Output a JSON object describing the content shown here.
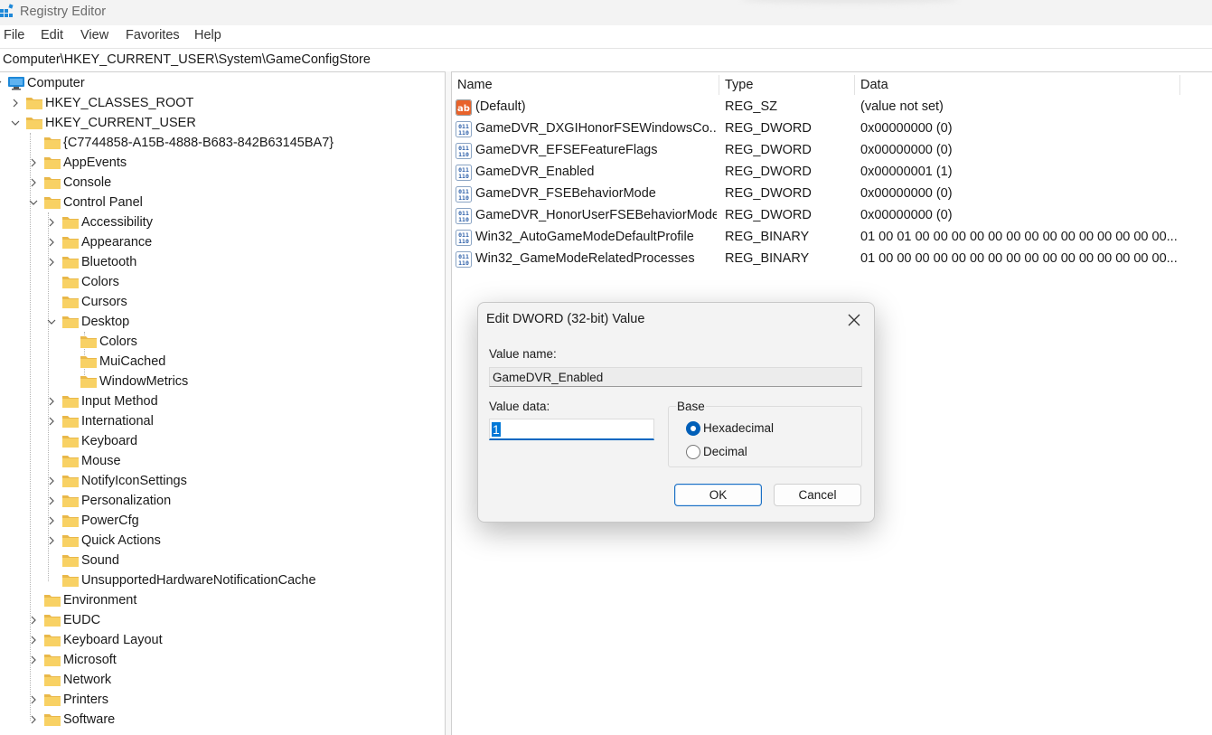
{
  "window": {
    "title": "Registry Editor"
  },
  "menu": [
    "File",
    "Edit",
    "View",
    "Favorites",
    "Help"
  ],
  "address": "Computer\\HKEY_CURRENT_USER\\System\\GameConfigStore",
  "tree": [
    {
      "label": "Computer",
      "icon": "computer-icon",
      "chevron": "down"
    },
    {
      "label": "HKEY_CLASSES_ROOT",
      "icon": "folder-icon",
      "chevron": "right"
    },
    {
      "label": "HKEY_CURRENT_USER",
      "icon": "folder-icon",
      "chevron": "down"
    },
    {
      "label": "{C7744858-A15B-4888-B683-842B63145BA7}",
      "icon": "folder-icon",
      "chevron": "none"
    },
    {
      "label": "AppEvents",
      "icon": "folder-icon",
      "chevron": "right"
    },
    {
      "label": "Console",
      "icon": "folder-icon",
      "chevron": "right"
    },
    {
      "label": "Control Panel",
      "icon": "folder-icon",
      "chevron": "down"
    },
    {
      "label": "Accessibility",
      "icon": "folder-icon",
      "chevron": "right"
    },
    {
      "label": "Appearance",
      "icon": "folder-icon",
      "chevron": "right"
    },
    {
      "label": "Bluetooth",
      "icon": "folder-icon",
      "chevron": "right"
    },
    {
      "label": "Colors",
      "icon": "folder-icon",
      "chevron": "none"
    },
    {
      "label": "Cursors",
      "icon": "folder-icon",
      "chevron": "none"
    },
    {
      "label": "Desktop",
      "icon": "folder-icon",
      "chevron": "down"
    },
    {
      "label": "Colors",
      "icon": "folder-icon",
      "chevron": "none"
    },
    {
      "label": "MuiCached",
      "icon": "folder-icon",
      "chevron": "none"
    },
    {
      "label": "WindowMetrics",
      "icon": "folder-icon",
      "chevron": "none"
    },
    {
      "label": "Input Method",
      "icon": "folder-icon",
      "chevron": "right"
    },
    {
      "label": "International",
      "icon": "folder-icon",
      "chevron": "right"
    },
    {
      "label": "Keyboard",
      "icon": "folder-icon",
      "chevron": "none"
    },
    {
      "label": "Mouse",
      "icon": "folder-icon",
      "chevron": "none"
    },
    {
      "label": "NotifyIconSettings",
      "icon": "folder-icon",
      "chevron": "right"
    },
    {
      "label": "Personalization",
      "icon": "folder-icon",
      "chevron": "right"
    },
    {
      "label": "PowerCfg",
      "icon": "folder-icon",
      "chevron": "right"
    },
    {
      "label": "Quick Actions",
      "icon": "folder-icon",
      "chevron": "right"
    },
    {
      "label": "Sound",
      "icon": "folder-icon",
      "chevron": "none"
    },
    {
      "label": "UnsupportedHardwareNotificationCache",
      "icon": "folder-icon",
      "chevron": "none"
    },
    {
      "label": "Environment",
      "icon": "folder-icon",
      "chevron": "none"
    },
    {
      "label": "EUDC",
      "icon": "folder-icon",
      "chevron": "right"
    },
    {
      "label": "Keyboard Layout",
      "icon": "folder-icon",
      "chevron": "right"
    },
    {
      "label": "Microsoft",
      "icon": "folder-icon",
      "chevron": "right"
    },
    {
      "label": "Network",
      "icon": "folder-icon",
      "chevron": "none"
    },
    {
      "label": "Printers",
      "icon": "folder-icon",
      "chevron": "right"
    },
    {
      "label": "Software",
      "icon": "folder-icon",
      "chevron": "right"
    }
  ],
  "columns": {
    "name": "Name",
    "type": "Type",
    "data": "Data"
  },
  "values": [
    {
      "name": "(Default)",
      "type": "REG_SZ",
      "data": "(value not set)",
      "icon": "string-value-icon"
    },
    {
      "name": "GameDVR_DXGIHonorFSEWindowsCo...",
      "type": "REG_DWORD",
      "data": "0x00000000 (0)",
      "icon": "binary-value-icon"
    },
    {
      "name": "GameDVR_EFSEFeatureFlags",
      "type": "REG_DWORD",
      "data": "0x00000000 (0)",
      "icon": "binary-value-icon"
    },
    {
      "name": "GameDVR_Enabled",
      "type": "REG_DWORD",
      "data": "0x00000001 (1)",
      "icon": "binary-value-icon"
    },
    {
      "name": "GameDVR_FSEBehaviorMode",
      "type": "REG_DWORD",
      "data": "0x00000000 (0)",
      "icon": "binary-value-icon"
    },
    {
      "name": "GameDVR_HonorUserFSEBehaviorMode",
      "type": "REG_DWORD",
      "data": "0x00000000 (0)",
      "icon": "binary-value-icon"
    },
    {
      "name": "Win32_AutoGameModeDefaultProfile",
      "type": "REG_BINARY",
      "data": "01 00 01 00 00 00 00 00 00 00 00 00 00 00 00 00 00...",
      "icon": "binary-value-icon"
    },
    {
      "name": "Win32_GameModeRelatedProcesses",
      "type": "REG_BINARY",
      "data": "01 00 00 00 00 00 00 00 00 00 00 00 00 00 00 00 00...",
      "icon": "binary-value-icon"
    }
  ],
  "dialog": {
    "title": "Edit DWORD (32-bit) Value",
    "value_name_label": "Value name:",
    "value_name": "GameDVR_Enabled",
    "value_data_label": "Value data:",
    "value_data": "1",
    "base_label": "Base",
    "base_options": [
      "Hexadecimal",
      "Decimal"
    ],
    "base_selected": "Hexadecimal",
    "ok": "OK",
    "cancel": "Cancel"
  },
  "colors": {
    "folder": "#f8d164",
    "accent": "#005fb8",
    "computer": "#1e88d8"
  }
}
